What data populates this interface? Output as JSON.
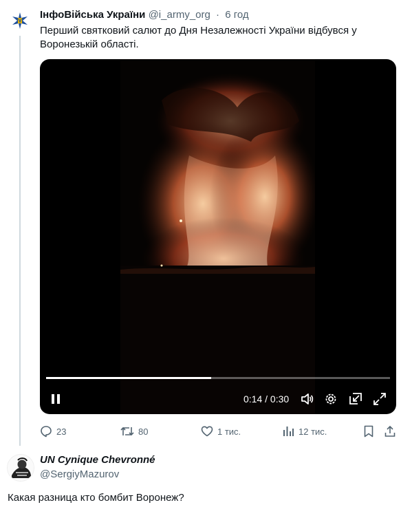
{
  "tweet": {
    "author_name": "ІнфоВійська України",
    "author_handle": "@i_army_org",
    "separator": "·",
    "time": "6 год",
    "text": "Перший святковий салют до Дня Незалежності України відбувся у Воронезькій області."
  },
  "video": {
    "current_time": "0:14",
    "duration": "0:30",
    "time_readout": "0:14 / 0:30",
    "progress": 0.48,
    "controls": [
      "pause-icon",
      "volume-icon",
      "settings-gear-icon",
      "picture-in-picture-icon",
      "fullscreen-icon"
    ]
  },
  "actions": {
    "replies": "23",
    "retweets": "80",
    "likes": "1 тис.",
    "views": "12 тис."
  },
  "reply": {
    "author_name": "UN Cynique Chevronné",
    "author_handle": "@SergiyMazurov",
    "text": "Какая разница кто бомбит Воронеж?"
  },
  "colors": {
    "text_primary": "#0f1419",
    "text_secondary": "#536471",
    "divider": "#cfd9de",
    "emblem_blue": "#1d4f9c"
  }
}
